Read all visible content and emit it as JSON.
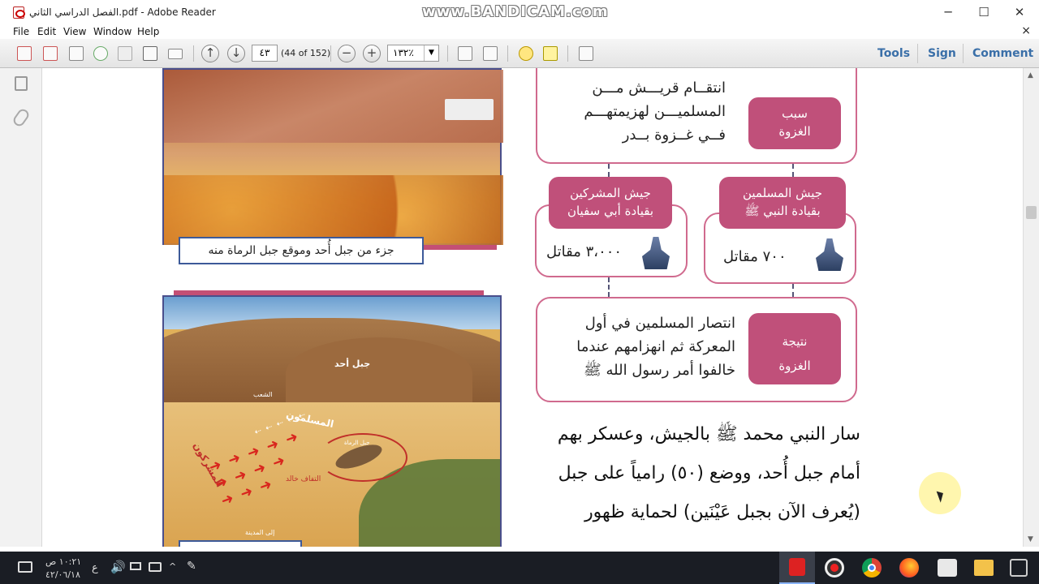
{
  "window": {
    "title": "الفصل الدراسي الثاني.pdf - Adobe Reader",
    "watermark": "www.BANDICAM.com",
    "minimize": "─",
    "maximize": "☐",
    "close": "✕"
  },
  "menubar": {
    "items": [
      "File",
      "Edit",
      "View",
      "Window",
      "Help"
    ],
    "close_doc": "×"
  },
  "toolbar": {
    "page_current": "٤٣",
    "page_count": "(44 of 152)",
    "zoom": "١٣٢٪",
    "zoom_out": "−",
    "zoom_in": "+",
    "right_links": [
      "Tools",
      "Sign",
      "Comment"
    ]
  },
  "page": {
    "photo1_caption": "جزء من جبل أُحد وموقع جبل الرماة منه",
    "map_labels": {
      "mountain": "جبل أحد",
      "muslims": "المسلمون",
      "polytheists": "المشركون",
      "khalid": "التفاف خالد",
      "pass": "الشعب",
      "medina": "إلى المدينة",
      "archers": "جبل الرماة"
    },
    "reason_label": "سبب الغزوة",
    "reason_text": [
      "انتقــام قريـــش مـــن",
      "المسلميـــن لهزيمتهـــم",
      "فــي غــزوة بــدر"
    ],
    "muslim_army_label": [
      "جيش المسلمين",
      "بقيادة النبي ﷺ"
    ],
    "muslim_army_count": "٧٠٠ مقاتل",
    "polytheist_army_label": [
      "جيش المشركين",
      "بقيادة أبي سفيان"
    ],
    "polytheist_army_count": "٣،٠٠٠ مقاتل",
    "result_label": "نتيجة الغزوة",
    "result_text": [
      "انتصار المسلمين في أول",
      "المعركة ثم انهزامهم عندما",
      "خالفوا أمر رسول الله ﷺ"
    ],
    "body_lines": [
      "سار النبي محمد ﷺ بالجيش، وعسكر بهم",
      "أمام جبل أُحد، ووضع (٥٠) رامياً على جبل",
      "(يُعرف الآن بجبل عَيْنَين)   لحماية ظهور"
    ]
  },
  "taskbar": {
    "time": "١٠:٢١ ص",
    "date": "٤٢/٠٦/١٨",
    "lang": "ع"
  },
  "colors": {
    "accent_pink": "#c0507a",
    "box_border": "#d06a8e",
    "link_blue": "#3a6fa8"
  }
}
